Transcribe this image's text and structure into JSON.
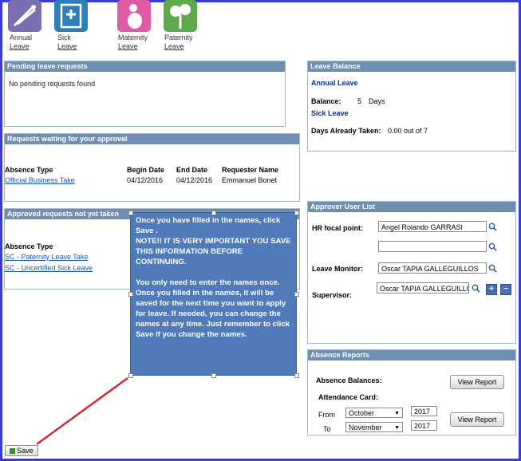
{
  "leave_tiles": [
    {
      "line1": "Annual",
      "line2": "Leave",
      "color": "#7a6fb2",
      "icon": "annual-leave-icon"
    },
    {
      "line1": "Sick",
      "line2": "Leave",
      "color": "#2d7fb8",
      "icon": "sick-leave-icon"
    },
    {
      "line1": "Maternity",
      "line2": "Leave",
      "color": "#e05aa6",
      "icon": "maternity-leave-icon"
    },
    {
      "line1": "Paternity",
      "line2": "Leave",
      "color": "#5fa84b",
      "icon": "paternity-leave-icon"
    }
  ],
  "pending": {
    "title": "Pending leave requests",
    "message": "No pending requests found"
  },
  "waiting": {
    "title": "Requests waiting for your approval",
    "headers": [
      "Absence Type",
      "Begin Date",
      "End Date",
      "Requester Name"
    ],
    "rows": [
      {
        "type": "Official Business Take",
        "begin": "04/12/2016",
        "end": "04/12/2016",
        "requester": "Emmanuel Bonet"
      }
    ]
  },
  "approved": {
    "title": "Approved requests not yet taken",
    "headers": [
      "Absence Type"
    ],
    "rows": [
      {
        "type": "SC - Paternity Leave Take"
      },
      {
        "type": "SC - Uncertified Sick Leave"
      }
    ]
  },
  "balance": {
    "title": "Leave Balance",
    "annual_label": "Annual Leave",
    "balance_label": "Balance:",
    "balance_value": "5",
    "balance_unit": "Days",
    "sick_label": "Sick Leave",
    "taken_label": "Days Already Taken:",
    "taken_value": "0.00 out of 7"
  },
  "approver": {
    "title": "Approver User List",
    "hr_label": "HR focal point:",
    "hr_value": "Angel Rolando GARRASI",
    "hr_value2": "",
    "monitor_label": "Leave Monitor:",
    "monitor_value": "Oscar TAPIA GALLEGUILLOS",
    "supervisor_label": "Supervisor:",
    "supervisor_value": "Oscar TAPIA GALLEGUILLOS",
    "add_symbol": "+",
    "remove_symbol": "−"
  },
  "reports": {
    "title": "Absence Reports",
    "balances_label": "Absence Balances:",
    "view_label": "View Report",
    "attendance_label": "Attendance Card:",
    "from_label": "From",
    "from_month": "October",
    "from_year": "2017",
    "to_label": "To",
    "to_month": "November",
    "to_year": "2017"
  },
  "callout": {
    "p1": "Once you have filled in the names, click Save .\nNOTE!! IT IS VERY IMPORTANT YOU SAVE THIS INFORMATION BEFORE CONTINUING.",
    "p2": "You only need to enter the names once. Once you filled in the names, it will be saved for the next time you want to apply for leave. If needed, you can change the names at any time.  Just remember to click Save if you change the names."
  },
  "save_label": "Save"
}
